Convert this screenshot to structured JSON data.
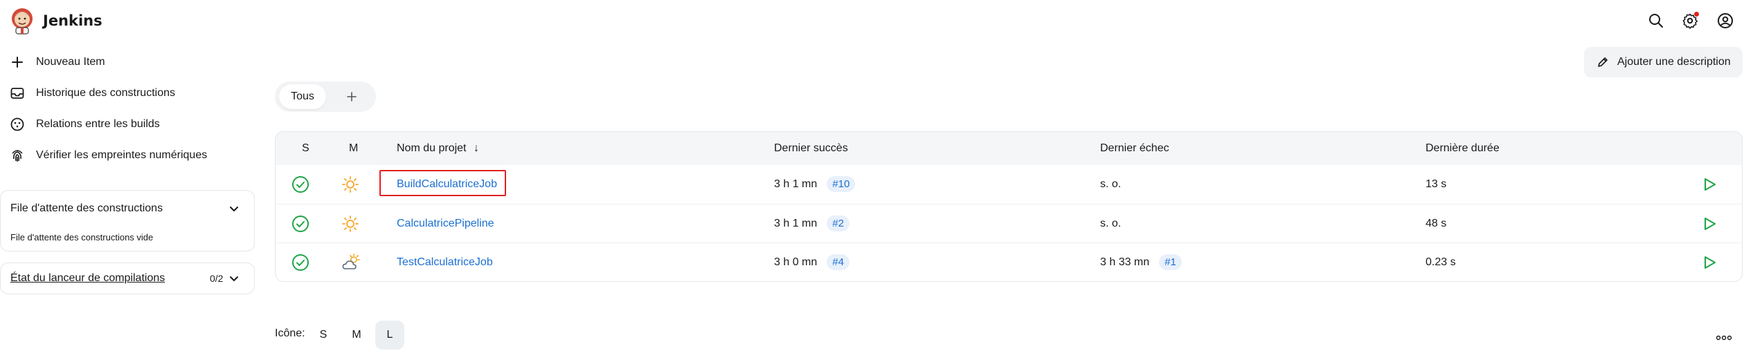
{
  "app": {
    "title": "Jenkins"
  },
  "header": {
    "icons": [
      "search-icon",
      "gear-icon",
      "user-icon"
    ],
    "notification_color": "#e2231a"
  },
  "sidebar": {
    "items": [
      {
        "label": "Nouveau Item",
        "icon": "plus-icon"
      },
      {
        "label": "Historique des constructions",
        "icon": "inbox-icon"
      },
      {
        "label": "Relations entre les builds",
        "icon": "relations-icon"
      },
      {
        "label": "Vérifier les empreintes numériques",
        "icon": "fingerprint-icon"
      }
    ],
    "queue": {
      "title": "File d'attente des constructions",
      "empty": "File d'attente des constructions vide"
    },
    "executors": {
      "title": "État du lanceur de compilations",
      "count": "0/2"
    }
  },
  "main": {
    "add_description": "Ajouter une description",
    "tabs": [
      {
        "label": "Tous"
      }
    ],
    "table": {
      "headers": {
        "s": "S",
        "m": "M",
        "name": "Nom du projet",
        "sort": "↓",
        "last_success": "Dernier succès",
        "last_failure": "Dernier échec",
        "last_duration": "Dernière durée"
      },
      "rows": [
        {
          "name": "BuildCalculatriceJob",
          "weather": "sunny",
          "last_success": "3 h 1 mn",
          "success_build": "#10",
          "last_failure": "s. o.",
          "failure_build": "",
          "duration": "13 s",
          "highlighted": true
        },
        {
          "name": "CalculatricePipeline",
          "weather": "sunny",
          "last_success": "3 h 1 mn",
          "success_build": "#2",
          "last_failure": "s. o.",
          "failure_build": "",
          "duration": "48 s",
          "highlighted": false
        },
        {
          "name": "TestCalculatriceJob",
          "weather": "partly-cloudy",
          "last_success": "3 h 0 mn",
          "success_build": "#4",
          "last_failure": "3 h 33 mn",
          "failure_build": "#1",
          "duration": "0.23 s",
          "highlighted": false
        }
      ]
    }
  },
  "footer": {
    "icon_label": "Icône:",
    "sizes": [
      "S",
      "M",
      "L"
    ],
    "selected_size": "L"
  },
  "colors": {
    "success": "#1ea446",
    "link": "#1b6fd1",
    "sun": "#f5a623",
    "highlight": "#e02020"
  }
}
